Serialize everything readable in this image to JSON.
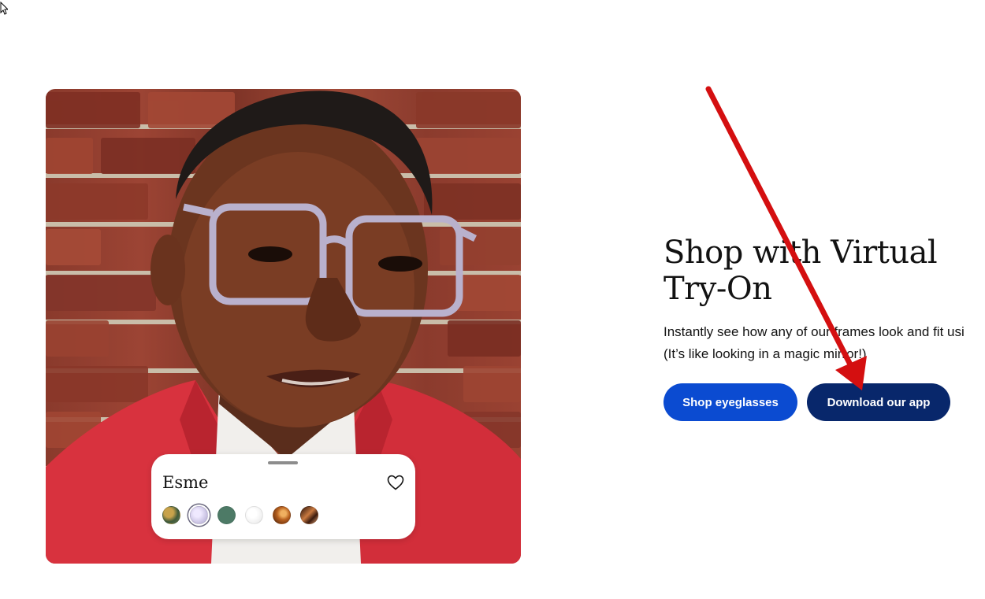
{
  "hero": {
    "headline_line1": "Shop with Virtual",
    "headline_line2": "Try-On",
    "subtext_line1": "Instantly see how any of our frames look and fit usi",
    "subtext_line2": "(It’s like looking in a magic mirror!)",
    "shop_button_label": "Shop eyeglasses",
    "app_button_label": "Download our app"
  },
  "tryon_card": {
    "frame_name": "Esme",
    "favorite_icon": "heart-outline-icon",
    "swatches": [
      {
        "name": "swatch-tortoise-green",
        "colors": [
          "#3f5a3a",
          "#c8a24b"
        ]
      },
      {
        "name": "swatch-lavender",
        "colors": [
          "#c6bfe0",
          "#e3ddf2"
        ],
        "selected": true
      },
      {
        "name": "swatch-green",
        "colors": [
          "#4d7a66",
          "#5e8a75"
        ]
      },
      {
        "name": "swatch-clear",
        "colors": [
          "#ececec",
          "#f8f8f8"
        ]
      },
      {
        "name": "swatch-tortoise-brown",
        "colors": [
          "#6b3111",
          "#d88a3c"
        ]
      },
      {
        "name": "swatch-dark-tortoise",
        "colors": [
          "#3a1a0e",
          "#c9793f"
        ]
      }
    ]
  },
  "colors": {
    "primary_button": "#0b4bd1",
    "secondary_button": "#08276b",
    "annotation_arrow": "#d40f10"
  },
  "icons": {
    "cursor": "mouse-cursor-icon",
    "annotation": "red-arrow-annotation"
  }
}
